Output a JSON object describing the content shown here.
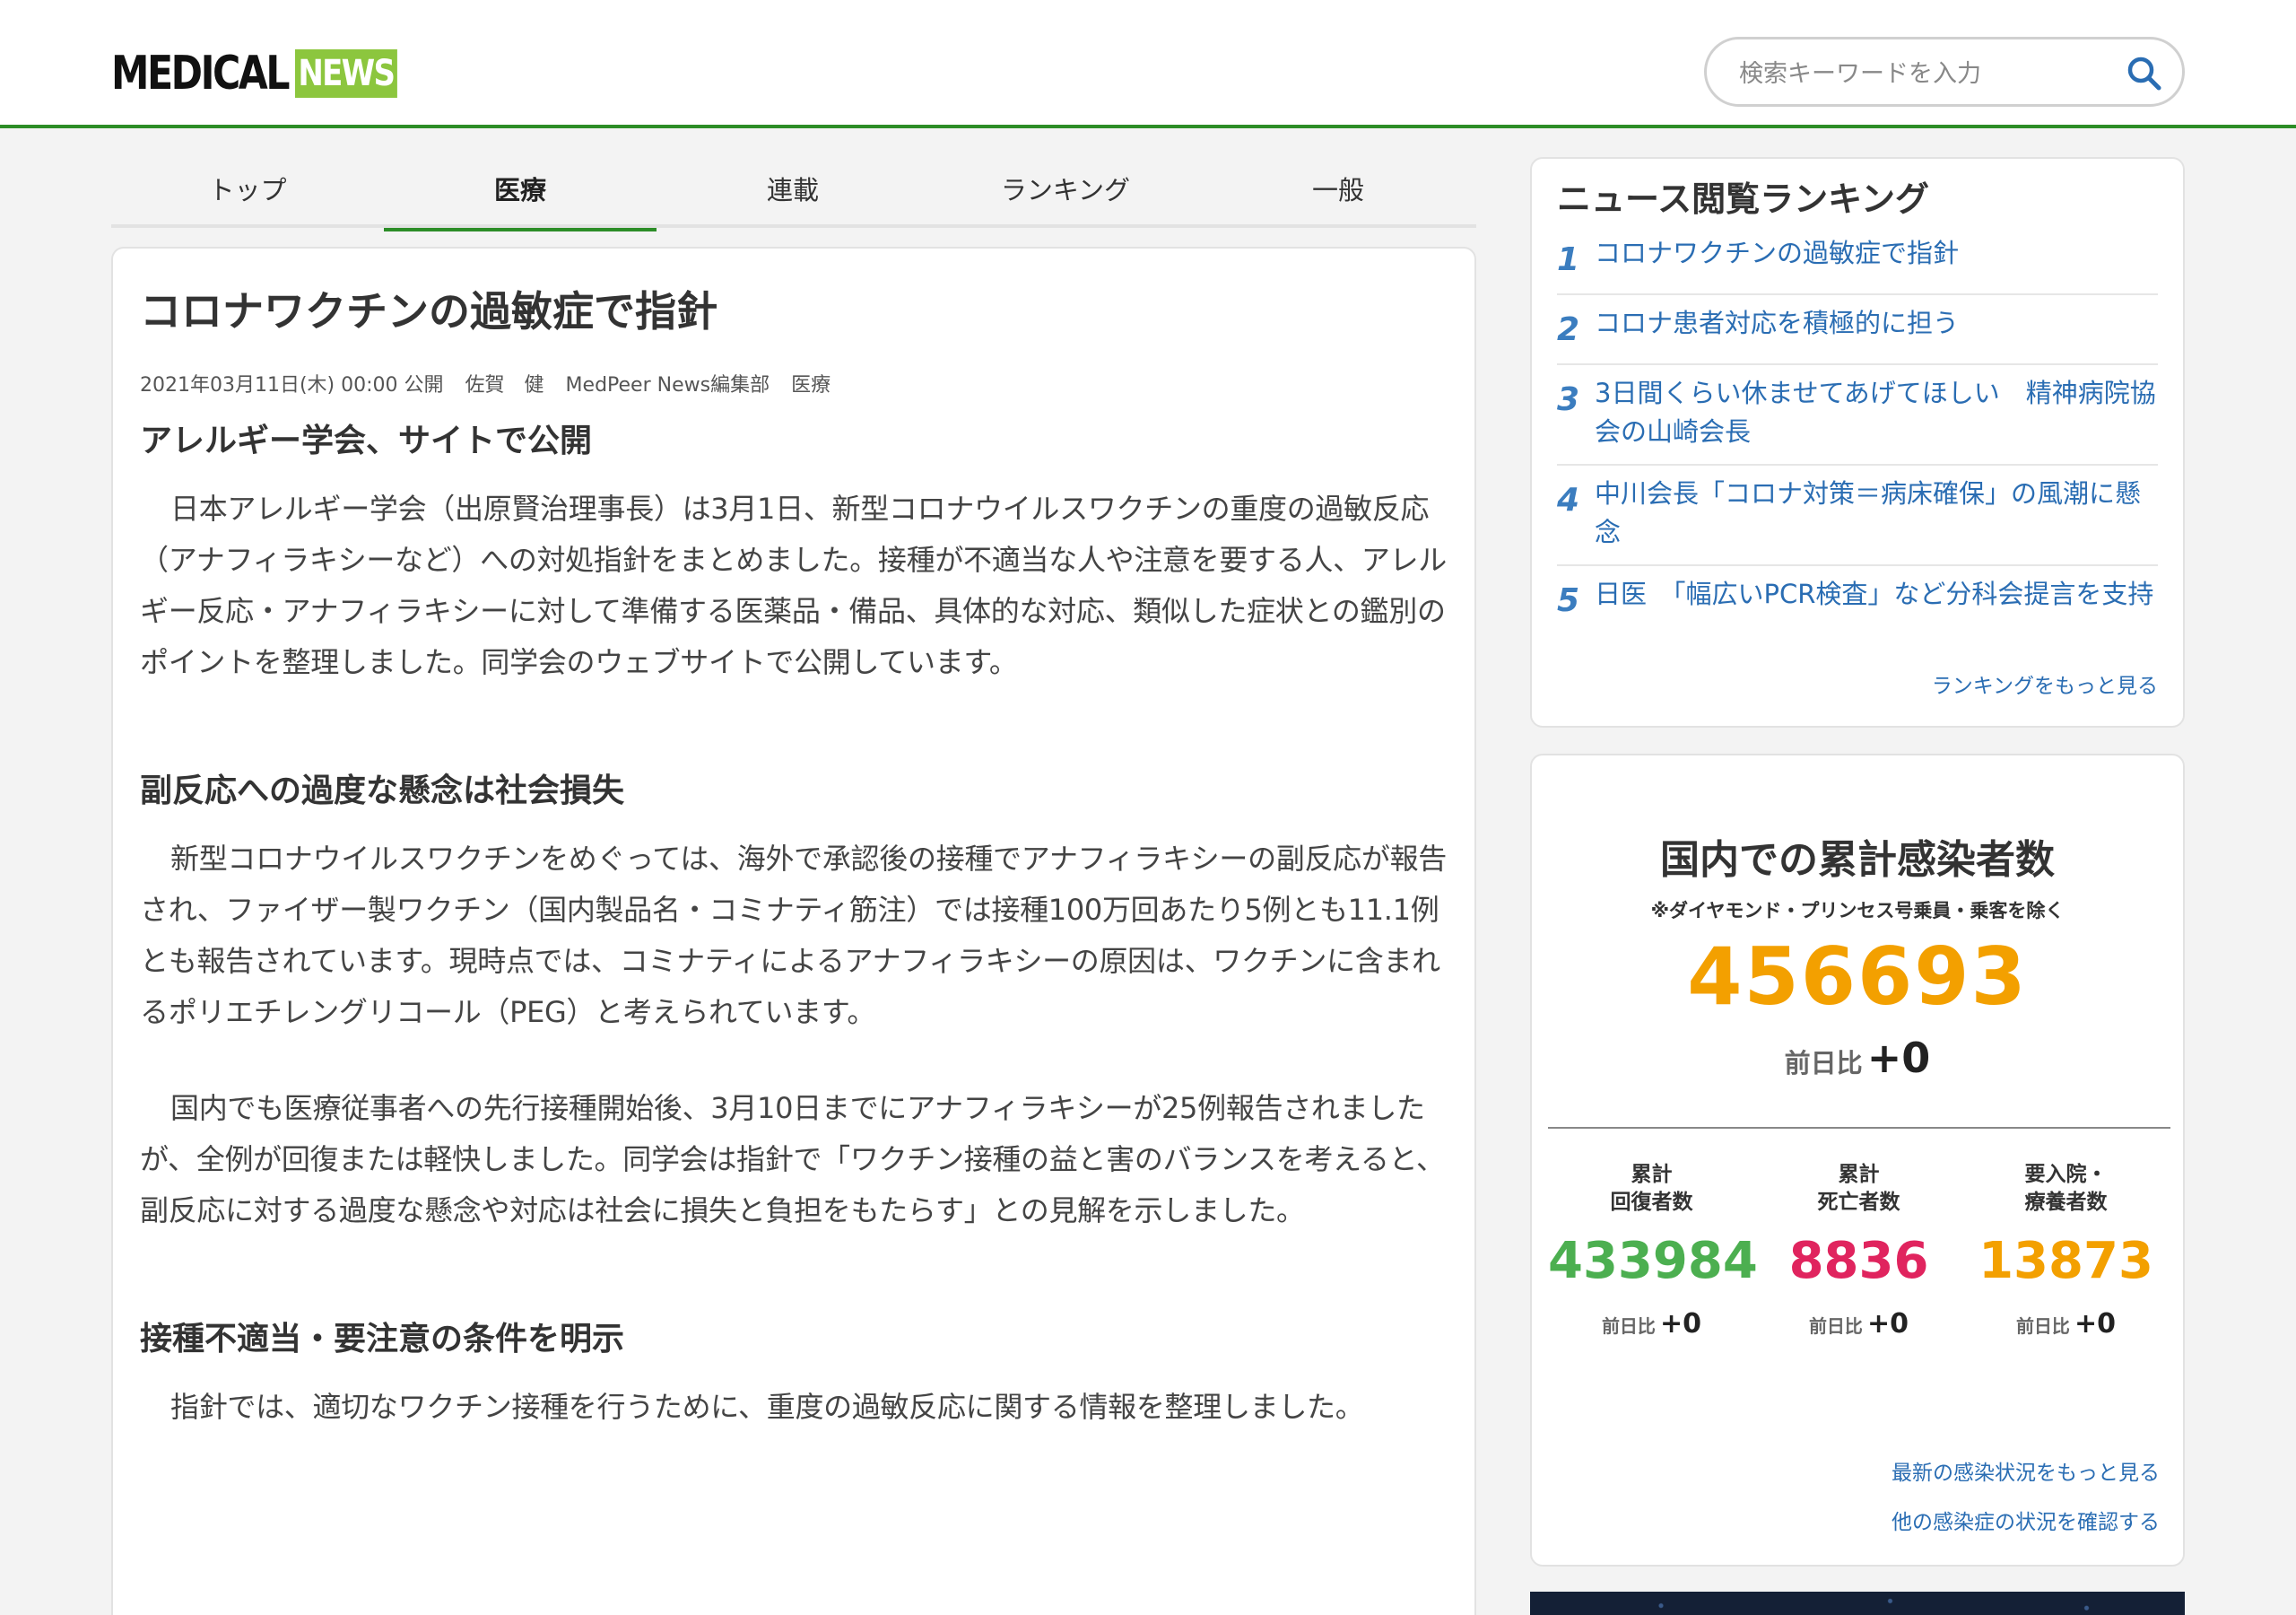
{
  "header": {
    "logo_medical": "MEDICAL",
    "logo_news": "NEWS",
    "search_placeholder": "検索キーワードを入力"
  },
  "tabs": [
    {
      "label": "トップ",
      "active": false
    },
    {
      "label": "医療",
      "active": true
    },
    {
      "label": "連載",
      "active": false
    },
    {
      "label": "ランキング",
      "active": false
    },
    {
      "label": "一般",
      "active": false
    }
  ],
  "article": {
    "title": "コロナワクチンの過敏症で指針",
    "meta": {
      "date": "2021年03月11日(木) 00:00 公開",
      "author": "佐賀　健",
      "department": "MedPeer News編集部",
      "category": "医療"
    },
    "section1_heading": "アレルギー学会、サイトで公開",
    "section1_para1": "日本アレルギー学会（出原賢治理事長）は3月1日、新型コロナウイルスワクチンの重度の過敏反応（アナフィラキシーなど）への対処指針をまとめました。接種が不適当な人や注意を要する人、アレルギー反応・アナフィラキシーに対して準備する医薬品・備品、具体的な対応、類似した症状との鑑別のポイントを整理しました。同学会のウェブサイトで公開しています。",
    "section2_heading": "副反応への過度な懸念は社会損失",
    "section2_para1": "新型コロナウイルスワクチンをめぐっては、海外で承認後の接種でアナフィラキシーの副反応が報告され、ファイザー製ワクチン（国内製品名・コミナティ筋注）では接種100万回あたり5例とも11.1例とも報告されています。現時点では、コミナティによるアナフィラキシーの原因は、ワクチンに含まれるポリエチレングリコール（PEG）と考えられています。",
    "section2_para2": "国内でも医療従事者への先行接種開始後、3月10日までにアナフィラキシーが25例報告されましたが、全例が回復または軽快しました。同学会は指針で「ワクチン接種の益と害のバランスを考えると、副反応に対する過度な懸念や対応は社会に損失と負担をもたらす」との見解を示しました。",
    "section3_heading": "接種不適当・要注意の条件を明示",
    "section3_para1": "指針では、適切なワクチン接種を行うために、重度の過敏反応に関する情報を整理しました。"
  },
  "ranking": {
    "title": "ニュース閲覧ランキング",
    "items": [
      {
        "num": "1",
        "text": "コロナワクチンの過敏症で指針"
      },
      {
        "num": "2",
        "text": "コロナ患者対応を積極的に担う"
      },
      {
        "num": "3",
        "text": "3日間くらい休ませてあげてほしい　精神病院協会の山崎会長"
      },
      {
        "num": "4",
        "text": "中川会長「コロナ対策＝病床確保」の風潮に懸念"
      },
      {
        "num": "5",
        "text": "日医　「幅広いPCR検査」など分科会提言を支持"
      }
    ],
    "more": "ランキングをもっと見る"
  },
  "covid": {
    "title": "国内での累計感染者数",
    "note": "※ダイヤモンド・プリンセス号乗員・乗客を除く",
    "total": "456693",
    "diff_label": "前日比",
    "diff_value": "+0",
    "stats": [
      {
        "label1": "累計",
        "label2": "回復者数",
        "value": "433984",
        "color": "#4caf50",
        "diff_value": "+0"
      },
      {
        "label1": "累計",
        "label2": "死亡者数",
        "value": "8836",
        "color": "#e0245e",
        "diff_value": "+0"
      },
      {
        "label1": "要入院・",
        "label2": "療養者数",
        "value": "13873",
        "color": "#f3a000",
        "diff_value": "+0"
      }
    ],
    "link_latest": "最新の感染状況をもっと見る",
    "link_other": "他の感染症の状況を確認する"
  },
  "colors": {
    "brand_green": "#2c8d27",
    "logo_news_bg": "#8cc63e",
    "link_blue": "#2a6db3",
    "total_orange": "#f3a000"
  }
}
